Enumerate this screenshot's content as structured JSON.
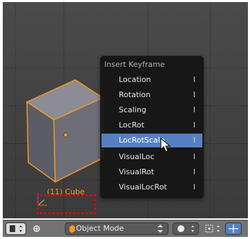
{
  "menu": {
    "title": "Insert Keyframe",
    "items": [
      {
        "label": "Location",
        "key": "I"
      },
      {
        "label": "Rotation",
        "key": "I"
      },
      {
        "label": "Scaling",
        "key": "I"
      },
      {
        "label": "LocRot",
        "key": "I"
      },
      {
        "label": "LocRotScale",
        "key": "I"
      },
      {
        "label": "VisualLoc",
        "key": "I"
      },
      {
        "label": "VisualRot",
        "key": "I"
      },
      {
        "label": "VisualLocRot",
        "key": "I"
      }
    ],
    "selected_label": "LocRotScale"
  },
  "viewport": {
    "object_label": "(11) Cube"
  },
  "header": {
    "mode_label": "Object Mode"
  },
  "colors": {
    "selection_blue": "#5680c2",
    "object_orange": "#ff9c28",
    "highlight_red": "#e80000"
  }
}
